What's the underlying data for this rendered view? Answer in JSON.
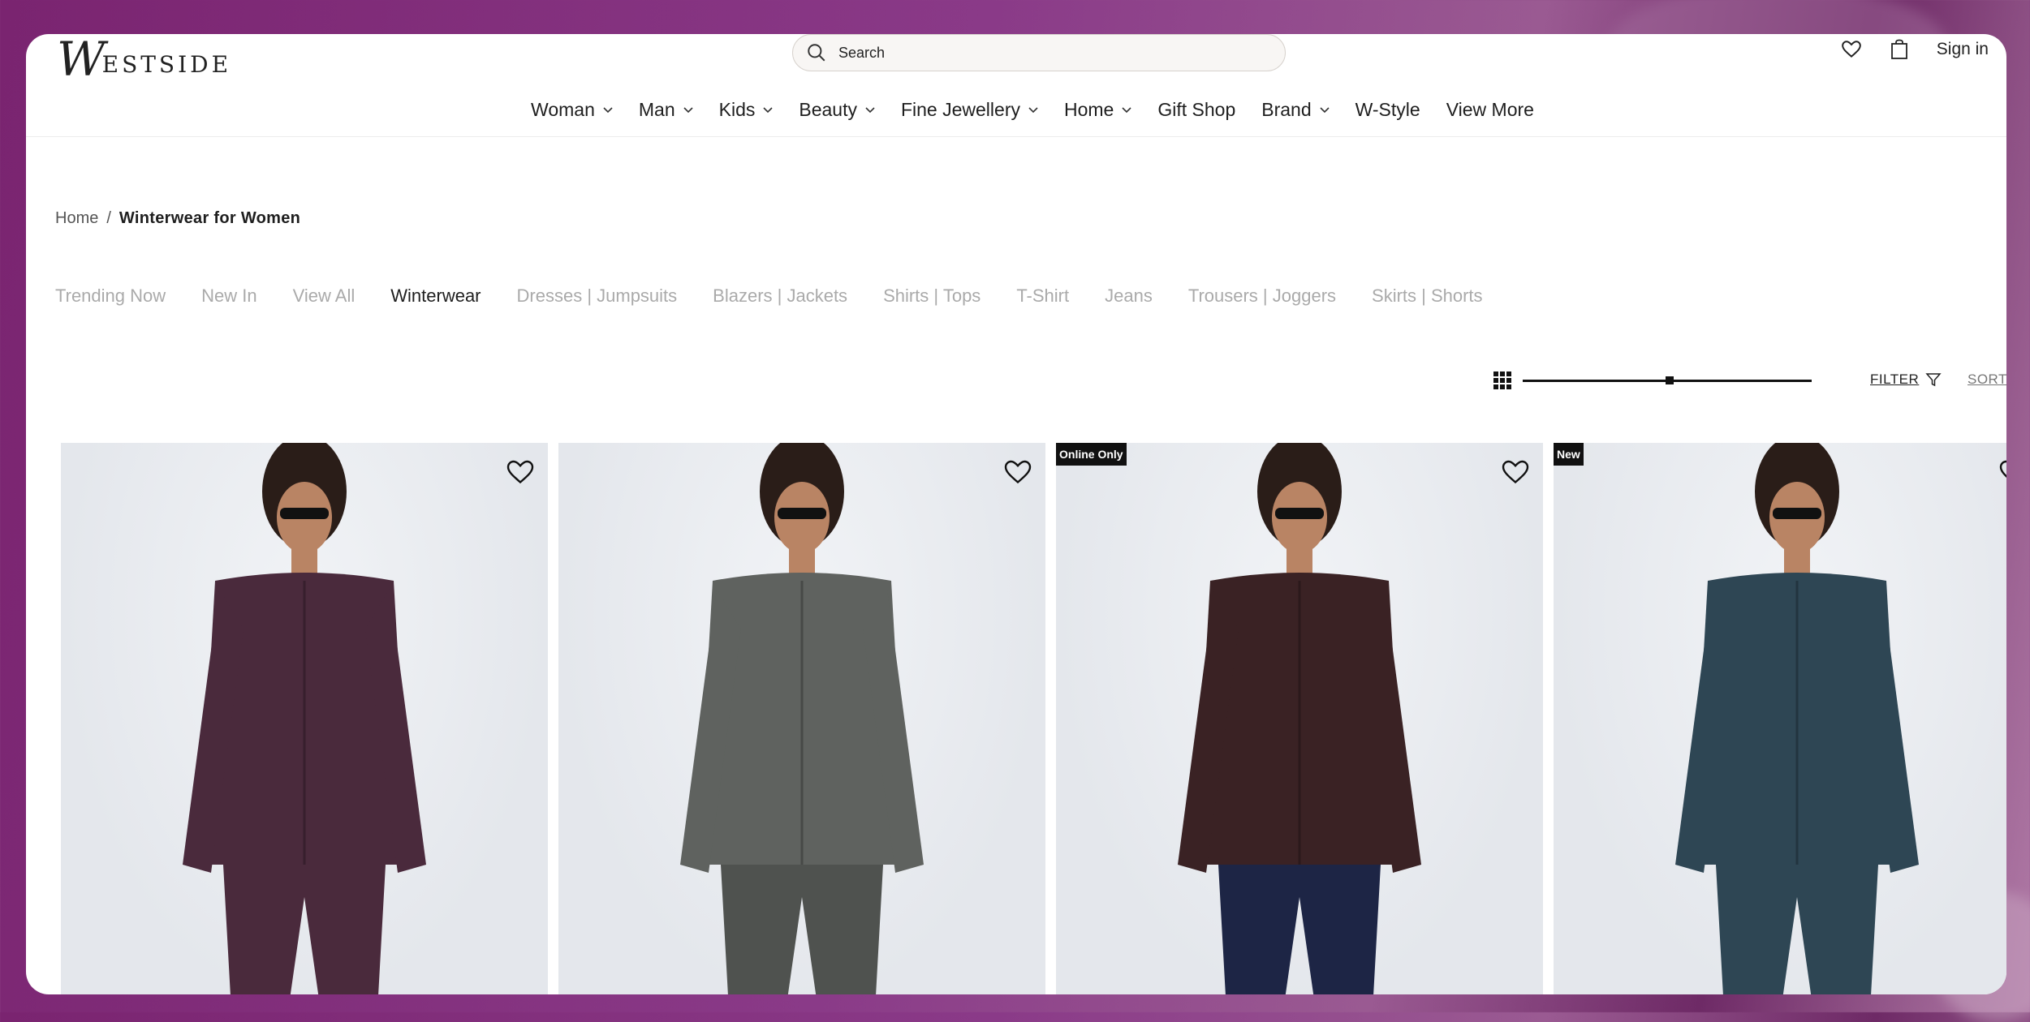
{
  "brand": {
    "logo_initial": "W",
    "logo_rest": "ESTSIDE"
  },
  "search": {
    "placeholder": "Search"
  },
  "header": {
    "signin_label": "Sign in"
  },
  "nav": {
    "items": [
      {
        "label": "Woman",
        "dropdown": true
      },
      {
        "label": "Man",
        "dropdown": true
      },
      {
        "label": "Kids",
        "dropdown": true
      },
      {
        "label": "Beauty",
        "dropdown": true
      },
      {
        "label": "Fine Jewellery",
        "dropdown": true
      },
      {
        "label": "Home",
        "dropdown": true
      },
      {
        "label": "Gift Shop",
        "dropdown": false
      },
      {
        "label": "Brand",
        "dropdown": true
      },
      {
        "label": "W-Style",
        "dropdown": false
      },
      {
        "label": "View More",
        "dropdown": false
      }
    ]
  },
  "breadcrumb": {
    "home": "Home",
    "sep": "/",
    "current": "Winterwear for Women"
  },
  "categories": [
    {
      "label": "Trending Now",
      "active": false
    },
    {
      "label": "New In",
      "active": false
    },
    {
      "label": "View All",
      "active": false
    },
    {
      "label": "Winterwear",
      "active": true
    },
    {
      "label": "Dresses | Jumpsuits",
      "active": false
    },
    {
      "label": "Blazers | Jackets",
      "active": false
    },
    {
      "label": "Shirts | Tops",
      "active": false
    },
    {
      "label": "T-Shirt",
      "active": false
    },
    {
      "label": "Jeans",
      "active": false
    },
    {
      "label": "Trousers | Joggers",
      "active": false
    },
    {
      "label": "Skirts | Shorts",
      "active": false
    }
  ],
  "toolbar": {
    "filter_label": "FILTER",
    "sort_label": "SORT"
  },
  "products": [
    {
      "badge": "",
      "jacket_color": "#4a2a3c",
      "pants_color": "#4a2a3c"
    },
    {
      "badge": "",
      "jacket_color": "#5f625f",
      "pants_color": "#4f524f"
    },
    {
      "badge": "Online Only",
      "jacket_color": "#3a2224",
      "pants_color": "#1d2545"
    },
    {
      "badge": "New",
      "jacket_color": "#2e4654",
      "pants_color": "#2e4654"
    }
  ],
  "colors": {
    "text": "#1e1e1e",
    "muted": "#aaaaaa",
    "frame": "#7a2470"
  }
}
